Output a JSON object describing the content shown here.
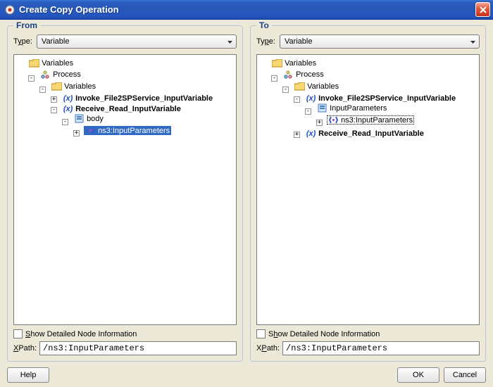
{
  "window": {
    "title": "Create Copy Operation"
  },
  "from": {
    "group_title": "From",
    "type_label": "Type:",
    "type_value": "Variable",
    "tree": {
      "root": "Variables",
      "process": "Process",
      "vars": "Variables",
      "invoke": "Invoke_File2SPService_InputVariable",
      "receive": "Receive_Read_InputVariable",
      "body": "body",
      "ns3": "ns3:InputParameters"
    },
    "show_detail_label": "Show Detailed Node Information",
    "xpath_label": "XPath:",
    "xpath_value": "/ns3:InputParameters"
  },
  "to": {
    "group_title": "To",
    "type_label": "Type:",
    "type_value": "Variable",
    "tree": {
      "root": "Variables",
      "process": "Process",
      "vars": "Variables",
      "invoke": "Invoke_File2SPService_InputVariable",
      "inputparams": "InputParameters",
      "ns3": "ns3:InputParameters",
      "receive": "Receive_Read_InputVariable"
    },
    "show_detail_label": "Show Detailed Node Information",
    "xpath_label": "XPath:",
    "xpath_value": "/ns3:InputParameters"
  },
  "buttons": {
    "help": "Help",
    "ok": "OK",
    "cancel": "Cancel"
  }
}
